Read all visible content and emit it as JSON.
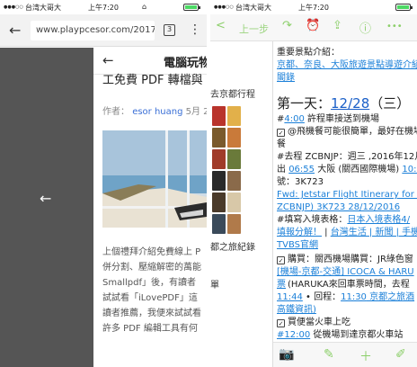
{
  "left": {
    "status": {
      "signal": "●●●○○",
      "carrier": "台湾大哥大",
      "time": "上午7:20",
      "battery_pct": 1.0
    },
    "urlbar": {
      "back": "←",
      "url": "www.playpcesor.com/2017/0",
      "tab_count": "3",
      "menu": "⋮"
    },
    "overlay_arrow": "←",
    "article": {
      "header_back": "←",
      "header_title": "電腦玩物",
      "title_line1": "轉檔與",
      "title_line2": "工免費 PDF 轉檔與",
      "author_label": "作者：",
      "author_name": "esor huang",
      "date": "5月 2",
      "body": [
        "上個禮拜介紹免費線上 P",
        "併分割、壓縮解密的萬能",
        "Smallpdf」後，有讀者",
        "試試看「iLovePDF」這",
        "讀者推薦，我便來試試看",
        "許多 PDF 編輯工具有何"
      ]
    }
  },
  "right": {
    "status": {
      "signal": "●●●○○",
      "carrier": "台湾大哥大",
      "time": "上午7:20",
      "battery_pct": 1.0
    },
    "toolbar": {
      "back": "<",
      "prev": "上一步",
      "next": "↷",
      "bell": "⏰",
      "share": "⇪",
      "info": "ⓘ",
      "more": "•••"
    },
    "gallery": {
      "text1": "去京都行程",
      "text2": "都之旅紀錄",
      "text3": "單"
    },
    "note": {
      "heading": "重要景點介紹：",
      "link_kyoto": "京都、奈良、大阪旅遊景點導遊介紹",
      "link_kyoto2": "閣錄",
      "day_label": "第一天：",
      "day_date": "12/28",
      "day_weekday": "（三）",
      "time1": "4:00",
      "text1": " 許程車接送到機場",
      "check1": "@飛機餐可能很簡單，最好在機場",
      "check1b": "餐",
      "flight1": "#去程 ZCBNJP：週三 ,2016年12月2",
      "flight2_pre": "出 ",
      "flight2_t1": "06:55",
      "flight2_mid": " 大阪 (關西國際機場) ",
      "flight2_t2": "10:30",
      "flight3": "號：3K723",
      "link_fwd": "Fwd: Jetstar Flight Itinerary for Book",
      "link_fwd2": "ZCBNJP) 3K723 28/12/2016",
      "entry": "#填寫入境表格：",
      "link_entry": "日本入境表格4/",
      "link_entry2": "填報分解！",
      "link_tw": "台灣生活 | 新聞 | 手機版",
      "link_tvbs": "TVBS官網",
      "check2": "購買：關西機場購買：JR綠色窗",
      "link_icoca": "[機場-京都-交通] ICOCA & HARU",
      "link_icoca2": "票",
      "check2b": "(HARUKA來回車票時間，去程 ",
      "t_1144": "11:44",
      "check2c": " • 回程：",
      "t_1130": "11:30",
      "check2d": " 京都之旅酒",
      "link_hotel": "高鐵資訊)",
      "check3": "買便當火車上吃",
      "time_last": "#12:00",
      "last_text": " 從機場到達京都火車站"
    },
    "bottom": {
      "camera": "📷",
      "pen": "✎",
      "add": "＋",
      "brush": "✐"
    }
  },
  "colors": {
    "accent_green": "#8ccf6a",
    "link_blue": "#1a7fd8",
    "battery_green": "#4cd964",
    "overlay_dark": "#555555"
  }
}
